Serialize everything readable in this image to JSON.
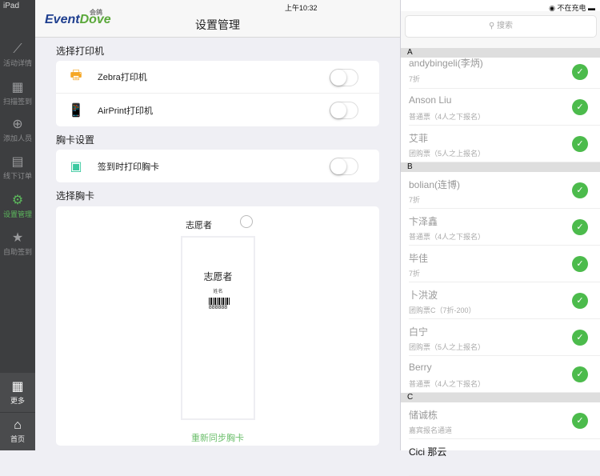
{
  "status": {
    "device": "iPad",
    "time": "上午10:32",
    "battery": "不在充电"
  },
  "sidebar": {
    "items": [
      {
        "label": "活动详情",
        "icon": "chart-icon"
      },
      {
        "label": "扫描签到",
        "icon": "qrcode-icon"
      },
      {
        "label": "添加人员",
        "icon": "add-user-icon"
      },
      {
        "label": "线下订单",
        "icon": "clipboard-icon"
      },
      {
        "label": "设置管理",
        "icon": "gear-icon",
        "active": true
      },
      {
        "label": "自助签到",
        "icon": "bookmark-star-icon"
      }
    ],
    "more": "更多",
    "home": "首页"
  },
  "header": {
    "logo": "EventDove",
    "logo_cn": "会鸽",
    "title": "设置管理"
  },
  "printer": {
    "section": "选择打印机",
    "items": [
      {
        "label": "Zebra打印机"
      },
      {
        "label": "AirPrint打印机"
      }
    ]
  },
  "badge_settings": {
    "section": "胸卡设置",
    "print_label": "签到时打印胸卡"
  },
  "badge_select": {
    "section": "选择胸卡",
    "name": "志愿者",
    "preview_title": "志愿者",
    "preview_name": "姓名",
    "preview_code": "888888",
    "resync": "重新同步胸卡"
  },
  "search": {
    "placeholder": "搜索"
  },
  "attendees": [
    {
      "letter": "A",
      "items": [
        {
          "name": "andybingeli(李炳)",
          "ticket": "7折"
        },
        {
          "name": "Anson Liu",
          "ticket": "普通票（4人之下报名）"
        },
        {
          "name": "艾菲",
          "ticket": "团购票（5人之上报名）"
        }
      ]
    },
    {
      "letter": "B",
      "items": [
        {
          "name": "bolian(连博)",
          "ticket": "7折"
        },
        {
          "name": "卞泽鑫",
          "ticket": "普通票（4人之下报名）"
        },
        {
          "name": "毕佳",
          "ticket": "7折"
        },
        {
          "name": "卜洪波",
          "ticket": "团购票C（7折-200）"
        },
        {
          "name": "白宁",
          "ticket": "团购票（5人之上报名）"
        },
        {
          "name": "Berry",
          "ticket": "普通票（4人之下报名）"
        }
      ]
    },
    {
      "letter": "C",
      "items": [
        {
          "name": "储诚栋",
          "ticket": "嘉宾报名通道"
        },
        {
          "name": "Cici 那云",
          "ticket": ""
        }
      ]
    }
  ],
  "colors": {
    "accent": "#5cb85c",
    "sidebar": "#3d3e40",
    "check": "#4cbb4c"
  }
}
